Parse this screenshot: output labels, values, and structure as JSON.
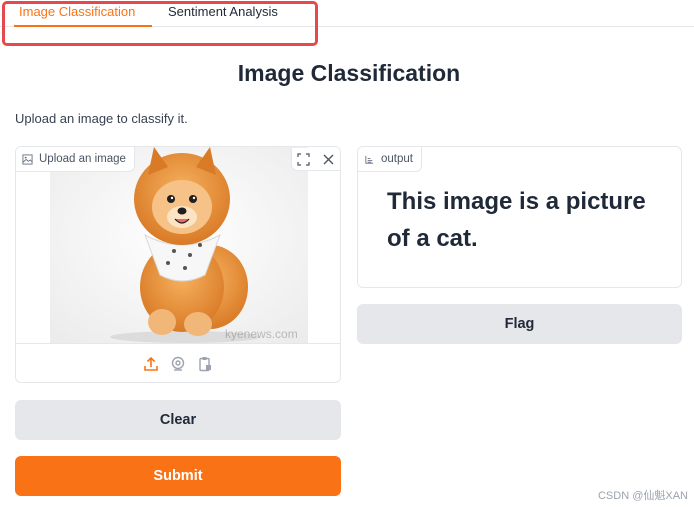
{
  "tabs": [
    {
      "label": "Image Classification",
      "active": true
    },
    {
      "label": "Sentiment Analysis",
      "active": false
    }
  ],
  "main": {
    "title": "Image Classification",
    "description": "Upload an image to classify it."
  },
  "input_panel": {
    "label": "Upload an image",
    "image_subject": "pomeranian puppy with bandana",
    "image_watermark": "kyenews.com",
    "tools": [
      "fullscreen-icon",
      "close-icon"
    ],
    "sources": [
      "upload-icon",
      "webcam-icon",
      "clipboard-icon"
    ]
  },
  "output_panel": {
    "label": "output",
    "text": "This image is a picture of a cat."
  },
  "buttons": {
    "flag": "Flag",
    "clear": "Clear",
    "submit": "Submit"
  },
  "footer": {
    "credit": "CSDN @仙魁XAN"
  },
  "colors": {
    "accent": "#f97316",
    "highlight": "#e5484d",
    "secondary_button": "#e5e7eb"
  }
}
